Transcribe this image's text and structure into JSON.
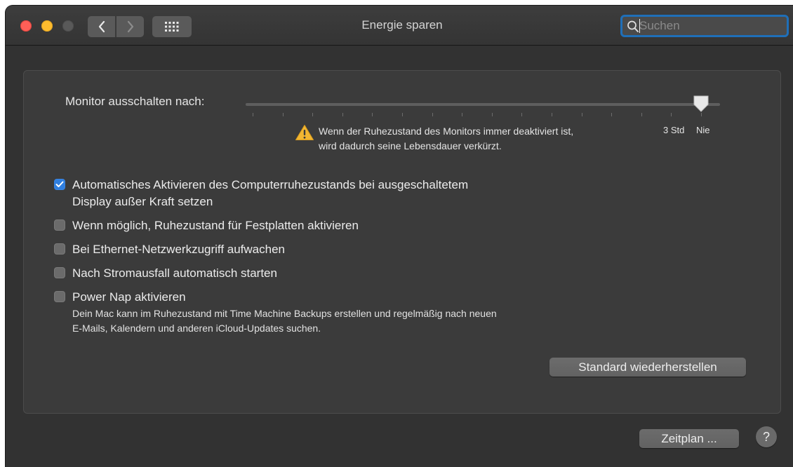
{
  "window": {
    "title": "Energie sparen"
  },
  "search": {
    "placeholder": "Suchen",
    "value": ""
  },
  "display_sleep": {
    "label": "Monitor ausschalten nach:",
    "value": "Nie",
    "tick_count": 16,
    "tick_labels": [
      "3 Std",
      "Nie"
    ],
    "warning": [
      "Wenn der Ruhezustand des Monitors immer deaktiviert ist,",
      "wird dadurch seine Lebensdauer verkürzt."
    ]
  },
  "options": [
    {
      "lines": [
        "Automatisches Aktivieren des Computerruhezustands bei ausgeschaltetem",
        "Display außer Kraft setzen"
      ],
      "checked": true
    },
    {
      "lines": [
        "Wenn möglich, Ruhezustand für Festplatten aktivieren"
      ],
      "checked": false
    },
    {
      "lines": [
        "Bei Ethernet-Netzwerkzugriff aufwachen"
      ],
      "checked": false
    },
    {
      "lines": [
        "Nach Stromausfall automatisch starten"
      ],
      "checked": false
    },
    {
      "lines": [
        "Power Nap aktivieren"
      ],
      "checked": false
    }
  ],
  "power_nap_note": [
    "Dein Mac kann im Ruhezustand mit Time Machine Backups erstellen und regelmäßig nach neuen",
    "E-Mails, Kalendern und anderen iCloud-Updates suchen."
  ],
  "buttons": {
    "restore_defaults": "Standard wiederherstellen",
    "schedule": "Zeitplan ...",
    "help": "?"
  },
  "colors": {
    "accent": "#2f7fe0",
    "close": "#fe5f57",
    "minimize": "#febc2e",
    "warning": "#f2b632"
  },
  "icons": {
    "back": "chevron-left-icon",
    "forward": "chevron-right-icon",
    "show_all": "grid-icon",
    "search": "magnifier-icon",
    "warning": "warning-triangle-icon",
    "checkmark": "checkmark-icon"
  }
}
